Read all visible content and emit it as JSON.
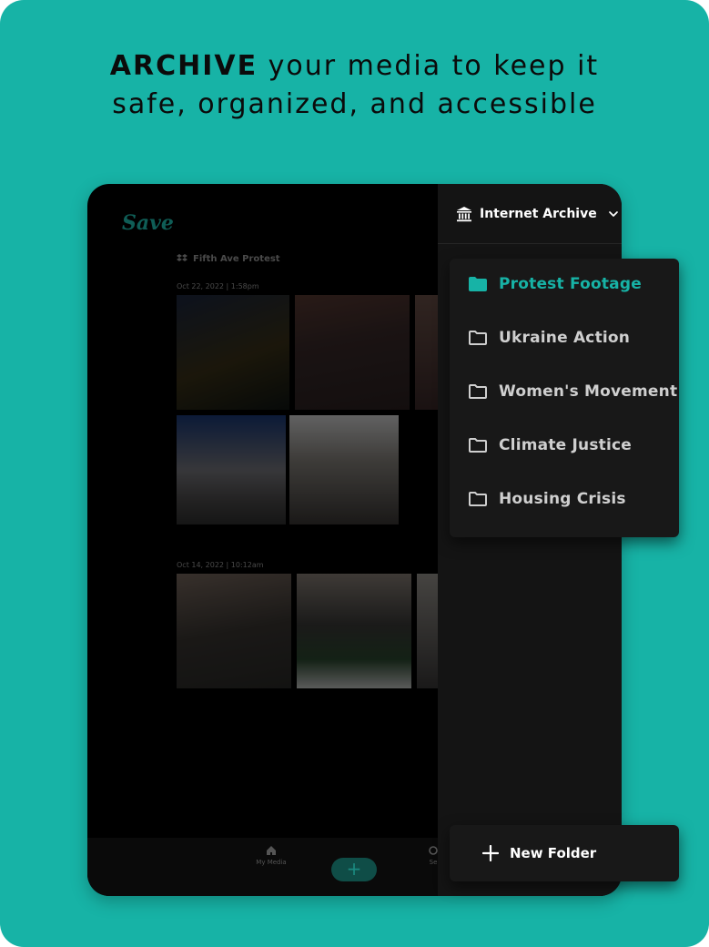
{
  "headline": {
    "bold": "ARCHIVE",
    "line1_rest": " your media to keep it",
    "line2": "safe, organized, and accessible"
  },
  "app": {
    "logo": "Save",
    "folder_name": "Fifth Ave Protest",
    "groups": [
      {
        "date": "Oct 22, 2022 | 1:58pm"
      },
      {
        "date": "Oct 14, 2022 | 10:12am"
      }
    ],
    "bottom_nav": {
      "my_media": "My Media",
      "add": "+",
      "settings": "Se"
    }
  },
  "panel": {
    "archive_name": "Internet Archive",
    "folders": [
      {
        "label": "Protest Footage",
        "active": true
      },
      {
        "label": "Ukraine Action",
        "active": false
      },
      {
        "label": "Women's Movement",
        "active": false
      },
      {
        "label": "Climate Justice",
        "active": false
      },
      {
        "label": "Housing Crisis",
        "active": false
      }
    ],
    "new_folder_label": "New Folder"
  },
  "colors": {
    "accent": "#17b3a6",
    "panel_bg": "#141414",
    "dropdown_bg": "#181818"
  }
}
